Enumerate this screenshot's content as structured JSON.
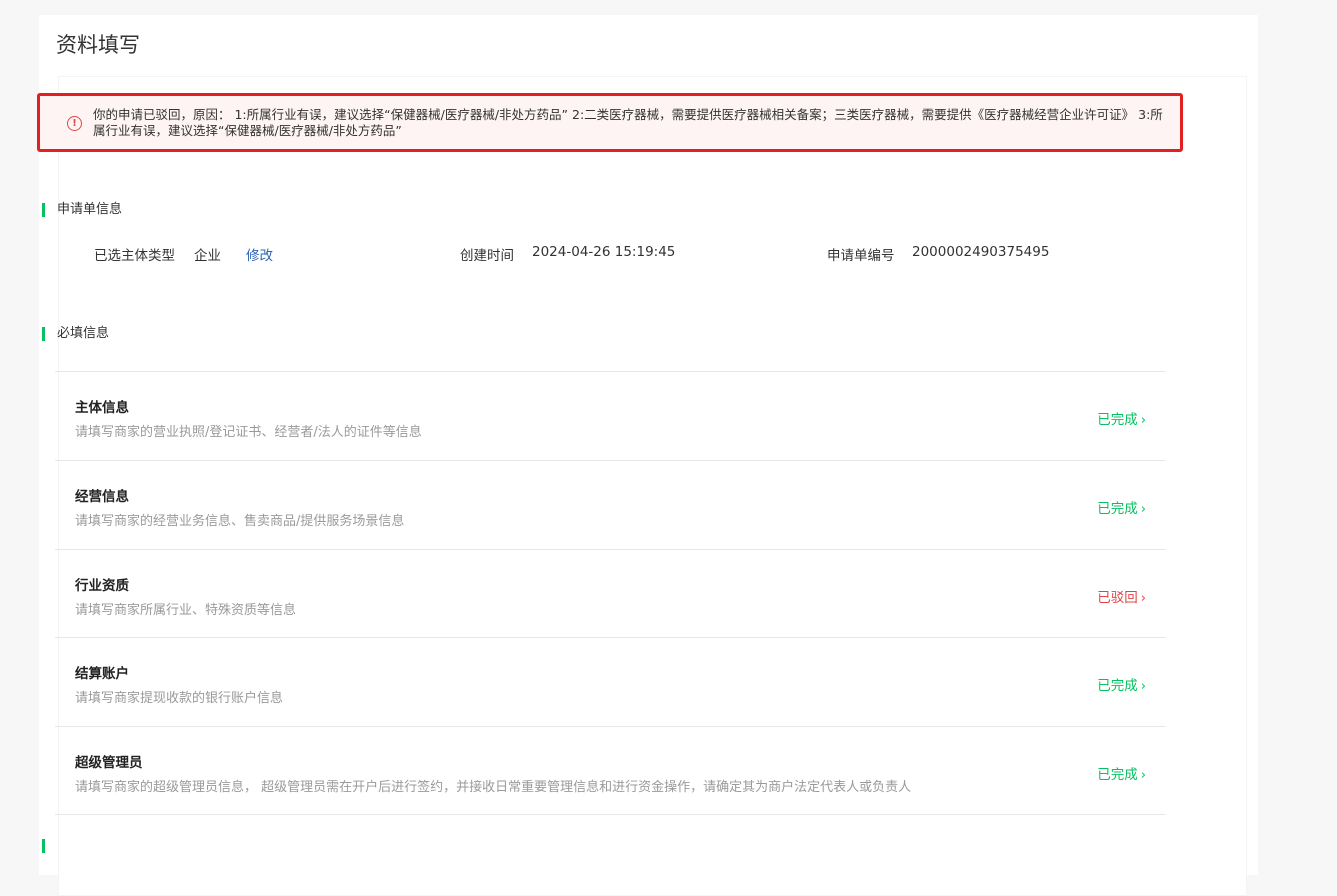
{
  "page": {
    "title": "资料填写"
  },
  "alert": {
    "icon": "alert-circle-icon",
    "message": "你的申请已驳回，原因： 1:所属行业有误，建议选择“保健器械/医疗器械/非处方药品” 2:二类医疗器械，需要提供医疗器械相关备案；三类医疗器械，需要提供《医疗器械经营企业许可证》 3:所属行业有误，建议选择“保健器械/医疗器械/非处方药品”"
  },
  "application": {
    "section_title": "申请单信息",
    "entity_type_label": "已选主体类型",
    "entity_type_value": "企业",
    "modify_label": "修改",
    "created_label": "创建时间",
    "created_value": "2024-04-26 15:19:45",
    "number_label": "申请单编号",
    "number_value": "2000002490375495"
  },
  "required": {
    "section_title": "必填信息",
    "items": [
      {
        "title": "主体信息",
        "desc": "请填写商家的营业执照/登记证书、经营者/法人的证件等信息",
        "status": "已完成",
        "state": "done"
      },
      {
        "title": "经营信息",
        "desc": "请填写商家的经营业务信息、售卖商品/提供服务场景信息",
        "status": "已完成",
        "state": "done"
      },
      {
        "title": "行业资质",
        "desc": "请填写商家所属行业、特殊资质等信息",
        "status": "已驳回",
        "state": "rejected"
      },
      {
        "title": "结算账户",
        "desc": "请填写商家提现收款的银行账户信息",
        "status": "已完成",
        "state": "done"
      },
      {
        "title": "超级管理员",
        "desc": "请填写商家的超级管理员信息， 超级管理员需在开户后进行签约，并接收日常重要管理信息和进行资金操作，请确定其为商户法定代表人或负责人",
        "status": "已完成",
        "state": "done"
      }
    ]
  },
  "colors": {
    "accent": "#07c160",
    "rejected": "#e04545",
    "link": "#2e64b7",
    "alert_border": "#e21f21",
    "alert_bg": "#fdf4f3"
  }
}
